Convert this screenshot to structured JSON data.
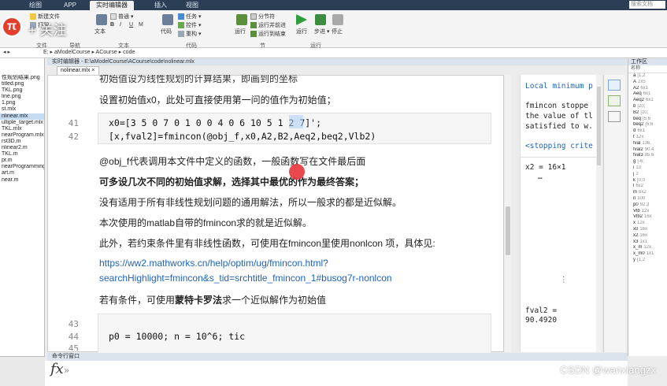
{
  "app": {
    "tabs": [
      "绘图",
      "APP",
      "实时编辑器",
      "插入",
      "视图"
    ],
    "help_search_placeholder": "搜索文档"
  },
  "overlay": {
    "logo_glyph": "π",
    "follow_text": "+ 关注"
  },
  "ribbon": {
    "file_new": "新建文件",
    "file_print": "打印",
    "file_group": "文件",
    "nav_group": "导航",
    "text_btn": "文本",
    "text_normal": "普通",
    "text_group": "文本",
    "code_btn": "代码",
    "task": "任务",
    "control": "控件",
    "refactor": "重构",
    "code_group": "代码",
    "section_btn": "运行",
    "section_break": "分节符",
    "run_advance": "运行并前进",
    "run_to_end": "运行到结束",
    "section_group": "节",
    "run_btn": "运行",
    "step_btn": "步进",
    "stop_btn": "停止",
    "run_group": "运行"
  },
  "path": {
    "segments": [
      "E:",
      "aModelCourse",
      "ACourse",
      "code"
    ]
  },
  "files": [
    "性规划结果.png",
    "titled.png",
    "TKL.png",
    "line.png",
    "1.png",
    "st.mlx",
    "nlinear.mlx",
    "ultiple_target.mlx",
    "TKL.mlx",
    "nearProgram.mlx",
    "rst3D.m",
    "nlinear2.m",
    "TKL.m",
    "pr.m",
    "nearProgramming2.m",
    "art.m",
    "near.m"
  ],
  "selected_file_index": 6,
  "editor": {
    "window_title": "实时编辑器 - E:\\aModelCourse\\ACourse\\code\\nolinear.mlx",
    "doc_tab": "nolinear.mlx",
    "top_partial": "初始值设为线性规划的计算结果，即画到的坐标",
    "init_text": "设置初始值x0，此处可直接使用第一问的值作为初始值；",
    "line_41_no": "41",
    "line_41_code": "x0=[3 5 0 7 0 1 0 0 4 0 6 10 5 1 2 7]';",
    "line_42_no": "42",
    "line_42_code": "[x,fval2]=fmincon(@obj_f,x0,A2,B2,Aeq2,beq2,Vlb2)",
    "note_obj": "@obj_f代表调用本文件中定义的函数，一般函数写在文件最后面",
    "note_bold": "可多设几次不同的初始值求解，选择其中最优的作为最终答案；",
    "note_general": "没有适用于所有非线性规划问题的通用解法，所以一般求的都是近似解。",
    "note_fmincon": "本次使用的matlab自带的fmincon求的就是近似解。",
    "note_nonlcon": "此外，若约束条件里有非线性函数，可使用在fmincon里使用nonlcon 项，具体见:",
    "link_line1": "https://ww2.mathworks.cn/help/optim/ug/fmincon.html?",
    "link_line2": "searchHighlight=fmincon&s_tid=srchtitle_fmincon_1#busog7r-nonlcon",
    "note_mc_prefix": "若有条件，可使用",
    "note_mc_bold": "蒙特卡罗法",
    "note_mc_suffix": "求一个近似解作为初始值",
    "line_43_no": "43",
    "line_44_no": "44",
    "line_44_code": "p0 = 10000; n = 10^6; tic",
    "line_45_no": "45"
  },
  "output": {
    "local_min": "Local minimum p",
    "msg1": "fmincon stoppe",
    "msg2": "the value of tl",
    "msg3": "satisfied to w.",
    "stopping": "<stopping crite",
    "x2": "x2 = 16×1",
    "dots": "…",
    "fval2_label": "fval2 =",
    "fval2_value": "90.4920"
  },
  "workspace": {
    "title": "工作区",
    "header": "名称",
    "rows": [
      [
        "a",
        "[1,2"
      ],
      [
        "A",
        "2x5"
      ],
      [
        "A2",
        "6x1"
      ],
      [
        "Aeq",
        "6x1"
      ],
      [
        "Aeq2",
        "6x1"
      ],
      [
        "b",
        "[20;"
      ],
      [
        "B2",
        "[20;"
      ],
      [
        "beq",
        "[5;6"
      ],
      [
        "beq2",
        "[5;6"
      ],
      [
        "d",
        "6x1"
      ],
      [
        "f",
        "12x"
      ],
      [
        "fval",
        "136."
      ],
      [
        "fval2",
        "90.4"
      ],
      [
        "fval3",
        "85.6"
      ],
      [
        "g",
        "[-6;"
      ],
      [
        "i",
        "13"
      ],
      [
        "j",
        "2"
      ],
      [
        "k",
        "[0;0"
      ],
      [
        "l",
        "6x2"
      ],
      [
        "m",
        "6x2"
      ],
      [
        "n",
        "100"
      ],
      [
        "p0",
        "92.3"
      ],
      [
        "Vlb",
        "12x"
      ],
      [
        "Vlb2",
        "16x"
      ],
      [
        "x",
        "12x"
      ],
      [
        "x0",
        "16x"
      ],
      [
        "x2",
        "16x"
      ],
      [
        "x3",
        "1x1"
      ],
      [
        "x_m",
        "12x"
      ],
      [
        "x_m0",
        "1x1"
      ],
      [
        "y",
        "[1,2"
      ]
    ]
  },
  "cmd": {
    "title": "命令行窗口",
    "fx": "fx",
    "prompt": "»"
  },
  "watermark": "CSDN @wanxiangzx"
}
